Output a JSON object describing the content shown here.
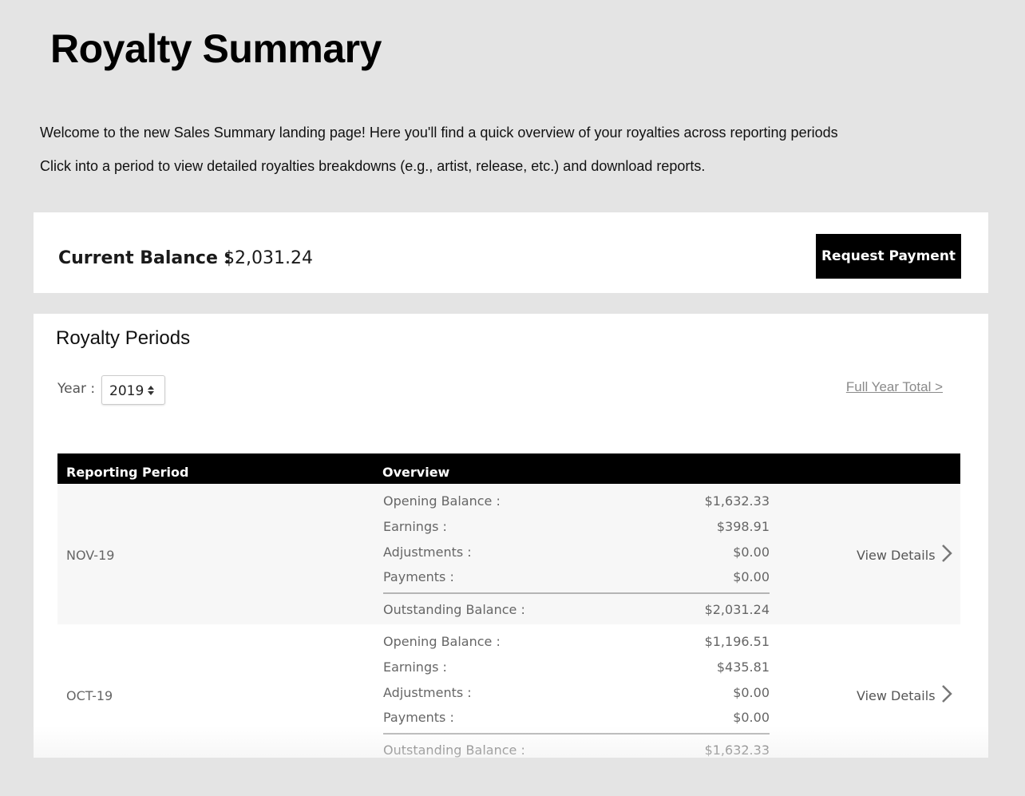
{
  "page": {
    "title": "Royalty Summary",
    "intro_line_1": "Welcome to the new Sales Summary landing page! Here you'll find a quick overview of your royalties across reporting periods",
    "intro_line_2": "Click into a period to view detailed royalties breakdowns (e.g., artist, release, etc.) and download reports."
  },
  "balance": {
    "label": "Current Balance :",
    "value": "$2,031.24",
    "request_button": "Request Payment"
  },
  "periods": {
    "title": "Royalty Periods",
    "year_label": "Year :",
    "year_selected": "2019",
    "full_year_link": "Full Year Total >",
    "columns": [
      "Reporting Period",
      "Overview"
    ],
    "rows": [
      {
        "period": "NOV-19",
        "lines": [
          {
            "label": "Opening Balance :",
            "value": "$1,632.33"
          },
          {
            "label": "Earnings :",
            "value": "$398.91"
          },
          {
            "label": "Adjustments :",
            "value": "$0.00"
          },
          {
            "label": "Payments :",
            "value": "$0.00"
          },
          {
            "label": "Outstanding Balance :",
            "value": "$2,031.24"
          }
        ],
        "action": "View Details"
      },
      {
        "period": "OCT-19",
        "lines": [
          {
            "label": "Opening Balance :",
            "value": "$1,196.51"
          },
          {
            "label": "Earnings :",
            "value": "$435.81"
          },
          {
            "label": "Adjustments :",
            "value": "$0.00"
          },
          {
            "label": "Payments :",
            "value": "$0.00"
          },
          {
            "label": "Outstanding Balance :",
            "value": "$1,632.33"
          }
        ],
        "action": "View Details"
      }
    ]
  },
  "colors": {
    "page_bg": "#e4e4e4",
    "panel_bg": "#ffffff",
    "header_bg": "#000000",
    "alt_row_bg": "#f7f7f7",
    "muted_text": "#666666",
    "link_text": "#8a8a8a"
  },
  "icons": {
    "year_select": "updown-icon",
    "row_action": "chevron-right-icon"
  }
}
